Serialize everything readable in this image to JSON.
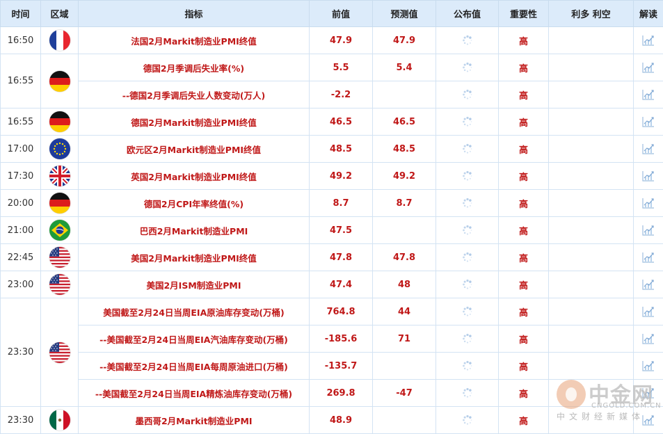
{
  "header": {
    "time": "时间",
    "region": "区域",
    "indicator": "指标",
    "previous": "前值",
    "forecast": "预测值",
    "actual": "公布值",
    "importance": "重要性",
    "impact": "利多 利空",
    "analysis": "解读"
  },
  "rows": [
    {
      "time": "16:50",
      "country": "france",
      "indicator": "法国2月Markit制造业PMI终值",
      "previous": "47.9",
      "forecast": "47.9",
      "importance": "高"
    },
    {
      "time": "16:55",
      "country": "germany",
      "indicator": "德国2月季调后失业率(%)",
      "previous": "5.5",
      "forecast": "5.4",
      "importance": "高"
    },
    {
      "time": "",
      "country": "",
      "indicator": "--德国2月季调后失业人数变动(万人)",
      "previous": "-2.2",
      "forecast": "",
      "importance": "高"
    },
    {
      "time": "16:55",
      "country": "germany",
      "indicator": "德国2月Markit制造业PMI终值",
      "previous": "46.5",
      "forecast": "46.5",
      "importance": "高"
    },
    {
      "time": "17:00",
      "country": "eurozone",
      "indicator": "欧元区2月Markit制造业PMI终值",
      "previous": "48.5",
      "forecast": "48.5",
      "importance": "高"
    },
    {
      "time": "17:30",
      "country": "uk",
      "indicator": "英国2月Markit制造业PMI终值",
      "previous": "49.2",
      "forecast": "49.2",
      "importance": "高"
    },
    {
      "time": "20:00",
      "country": "germany",
      "indicator": "德国2月CPI年率终值(%)",
      "previous": "8.7",
      "forecast": "8.7",
      "importance": "高"
    },
    {
      "time": "21:00",
      "country": "brazil",
      "indicator": "巴西2月Markit制造业PMI",
      "previous": "47.5",
      "forecast": "",
      "importance": "高"
    },
    {
      "time": "22:45",
      "country": "usa",
      "indicator": "美国2月Markit制造业PMI终值",
      "previous": "47.8",
      "forecast": "47.8",
      "importance": "高"
    },
    {
      "time": "23:00",
      "country": "usa",
      "indicator": "美国2月ISM制造业PMI",
      "previous": "47.4",
      "forecast": "48",
      "importance": "高"
    },
    {
      "time": "23:30",
      "country": "usa",
      "indicator": "美国截至2月24日当周EIA原油库存变动(万桶)",
      "previous": "764.8",
      "forecast": "44",
      "importance": "高"
    },
    {
      "time": "",
      "country": "",
      "indicator": "--美国截至2月24日当周EIA汽油库存变动(万桶)",
      "previous": "-185.6",
      "forecast": "71",
      "importance": "高"
    },
    {
      "time": "",
      "country": "",
      "indicator": "--美国截至2月24日当周EIA每周原油进口(万桶)",
      "previous": "-135.7",
      "forecast": "",
      "importance": "高"
    },
    {
      "time": "",
      "country": "",
      "indicator": "--美国截至2月24日当周EIA精炼油库存变动(万桶)",
      "previous": "269.8",
      "forecast": "-47",
      "importance": "高"
    },
    {
      "time": "23:30",
      "country": "mexico",
      "indicator": "墨西哥2月Markit制造业PMI",
      "previous": "48.9",
      "forecast": "",
      "importance": "高"
    }
  ],
  "watermark": {
    "title": "中金网",
    "domain": "CNGOLD.COM.CN",
    "slogan": "中文财经新媒体"
  },
  "colors": {
    "header_bg": "#dcebfa",
    "accent_red": "#c01818",
    "border": "#d3e3f3"
  }
}
